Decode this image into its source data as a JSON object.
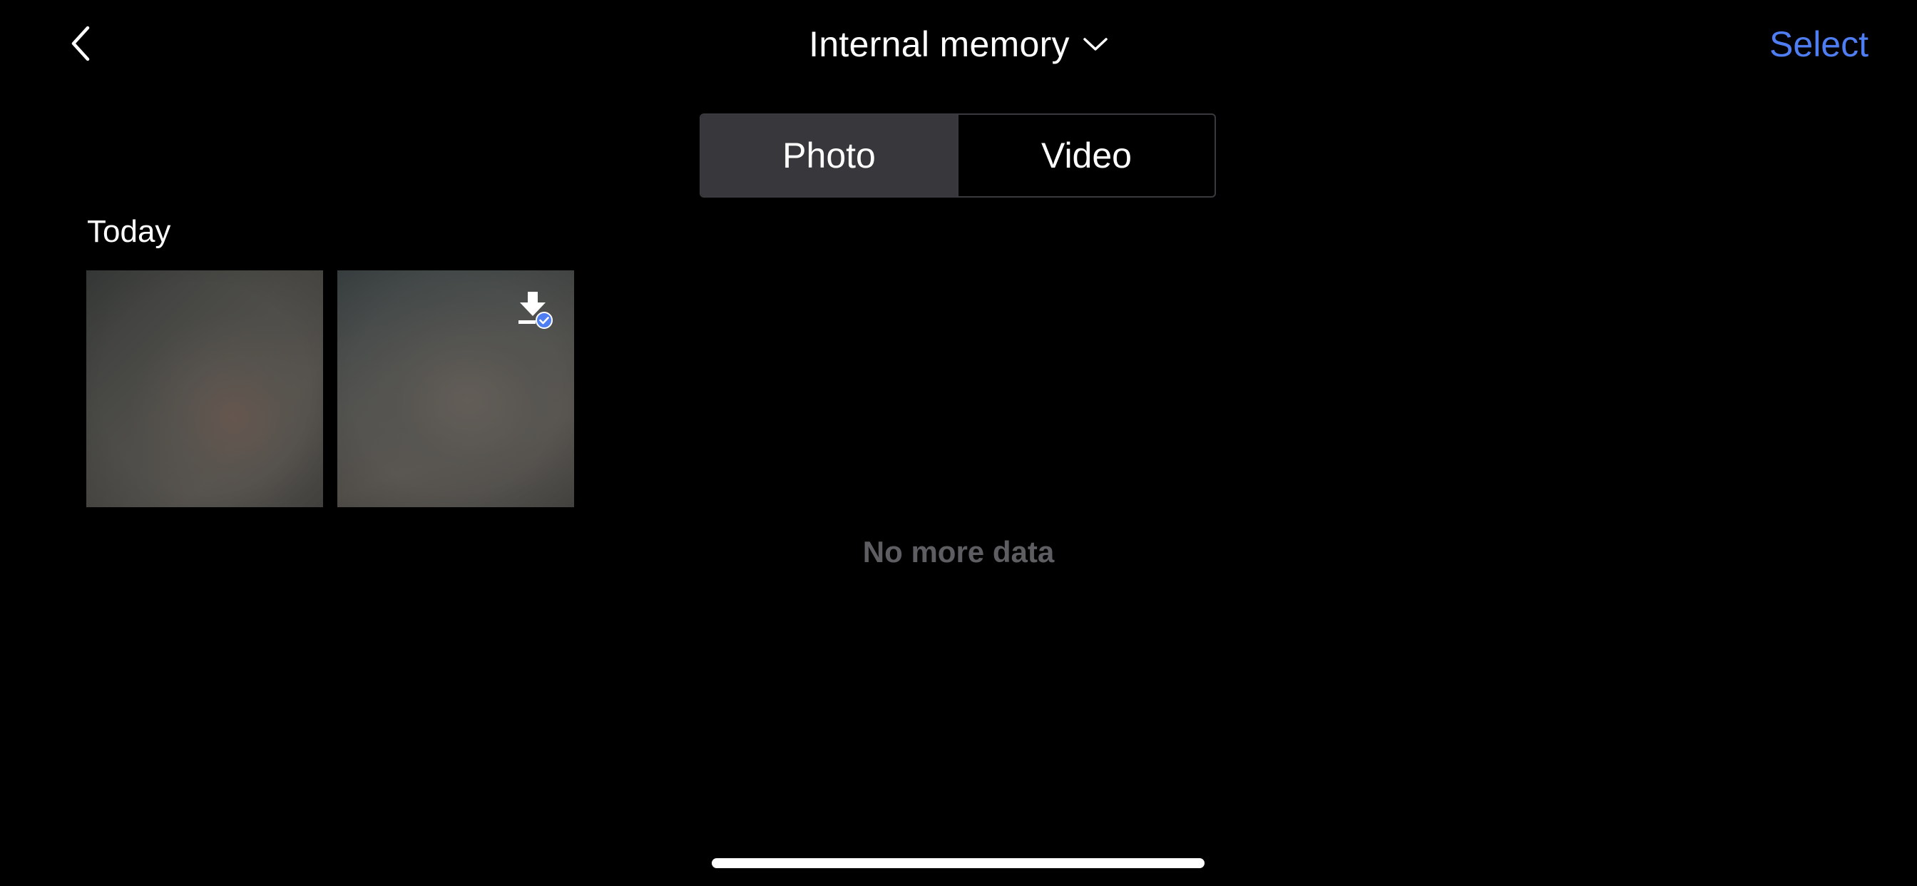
{
  "header": {
    "title": "Internal memory",
    "select_label": "Select",
    "accent_color": "#4f7df2"
  },
  "tabs": [
    {
      "label": "Photo",
      "active": true
    },
    {
      "label": "Video",
      "active": false
    }
  ],
  "section": {
    "heading": "Today"
  },
  "media_items": [
    {
      "type": "photo",
      "downloaded": false
    },
    {
      "type": "photo",
      "downloaded": true
    }
  ],
  "footer": {
    "status_text": "No more data"
  },
  "icons": {
    "back": "chevron-left-icon",
    "title_dropdown": "chevron-down-icon",
    "download_badge": "download-check-icon"
  }
}
